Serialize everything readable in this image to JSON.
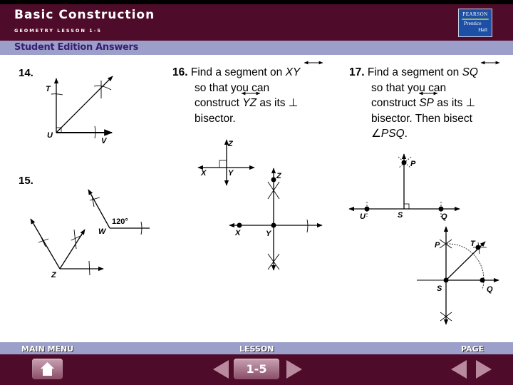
{
  "header": {
    "title": "Basic Construction",
    "subtitle": "GEOMETRY LESSON 1-5",
    "section": "Student Edition Answers",
    "logo": {
      "line1": "PEARSON",
      "line2": "Prentice",
      "line3": "Hall"
    }
  },
  "problems": {
    "p14": {
      "number": "14.",
      "labels": {
        "T": "T",
        "U": "U",
        "V": "V"
      }
    },
    "p15": {
      "number": "15.",
      "labels": {
        "W": "W",
        "Z": "Z",
        "angle": "120°"
      }
    },
    "p16": {
      "number": "16.",
      "line1a": "Find a segment on ",
      "line1b": "XY",
      "line2": "so that you can",
      "line3a": "construct ",
      "line3b": "YZ",
      "line3c": " as its ⊥",
      "line4": "bisector.",
      "labels": {
        "X": "X",
        "Y": "Y",
        "Z": "Z"
      }
    },
    "p17": {
      "number": "17.",
      "line1a": "Find a segment on ",
      "line1b": "SQ",
      "line2": "so that you can",
      "line3a": "construct ",
      "line3b": "SP",
      "line3c": " as its ⊥",
      "line4": "bisector. Then bisect",
      "line5a": "∠",
      "line5b": "PSQ",
      "line5c": ".",
      "labels": {
        "U": "U",
        "S": "S",
        "Q": "Q",
        "P": "P",
        "T": "T"
      }
    }
  },
  "footer": {
    "main_menu_label": "MAIN MENU",
    "lesson_label": "LESSON",
    "lesson_value": "1-5",
    "page_label": "PAGE"
  },
  "colors": {
    "header_bg": "#4f0b2a",
    "band_bg": "#9b9fc9",
    "band_text": "#3a1d70",
    "logo_bg": "#1c4fa5"
  }
}
